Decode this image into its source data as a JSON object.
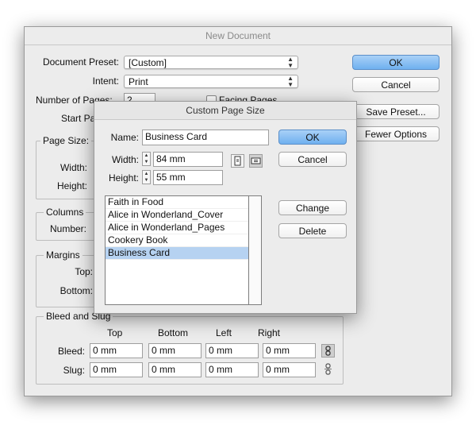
{
  "main": {
    "title": "New Document",
    "preset_label": "Document Preset:",
    "preset_value": "[Custom]",
    "intent_label": "Intent:",
    "intent_value": "Print",
    "num_pages_label": "Number of Pages:",
    "num_pages_value": "2",
    "facing_pages_label": "Facing Pages",
    "start_page_label": "Start Pa",
    "page_size_group": "Page Size:",
    "width_label": "Width:",
    "height_label": "Height:",
    "columns_group": "Columns",
    "number_label": "Number:",
    "margins_group": "Margins",
    "top_label": "Top:",
    "bottom_label": "Bottom:",
    "bleed_slug_group": "Bleed and Slug",
    "col_top": "Top",
    "col_bottom": "Bottom",
    "col_left": "Left",
    "col_right": "Right",
    "bleed_label": "Bleed:",
    "slug_label": "Slug:",
    "bleed_values": [
      "0 mm",
      "0 mm",
      "0 mm",
      "0 mm"
    ],
    "slug_values": [
      "0 mm",
      "0 mm",
      "0 mm",
      "0 mm"
    ],
    "ok_label": "OK",
    "cancel_label": "Cancel",
    "save_preset_label": "Save Preset...",
    "fewer_options_label": "Fewer Options"
  },
  "custom": {
    "title": "Custom Page Size",
    "name_label": "Name:",
    "name_value": "Business Card",
    "width_label": "Width:",
    "width_value": "84 mm",
    "height_label": "Height:",
    "height_value": "55 mm",
    "ok_label": "OK",
    "cancel_label": "Cancel",
    "change_label": "Change",
    "delete_label": "Delete",
    "sizes": [
      "Faith in Food",
      "Alice in Wonderland_Cover",
      "Alice in Wonderland_Pages",
      "Cookery Book",
      "Business Card"
    ],
    "selected_index": 4
  },
  "icons": {
    "dropdown": "up-down-arrows-icon",
    "orientation_portrait": "portrait-orientation-icon",
    "orientation_landscape": "landscape-orientation-icon",
    "link": "link-chain-icon"
  },
  "colors": {
    "default_button": "#6fb0ef",
    "selection": "#b6d2f1",
    "dialog_bg": "#ececec"
  }
}
